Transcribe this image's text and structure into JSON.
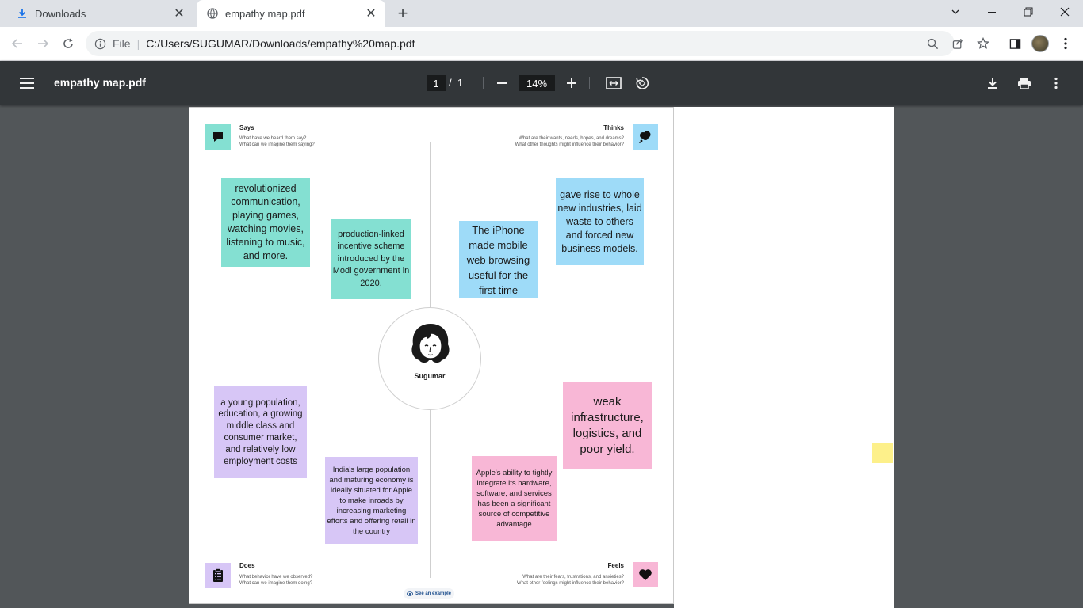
{
  "browser": {
    "tabs": [
      {
        "title": "Downloads",
        "icon": "download-icon",
        "active": false
      },
      {
        "title": "empathy map.pdf",
        "icon": "globe-icon",
        "active": true
      }
    ],
    "omnibox": {
      "scheme_label": "File",
      "url": "C:/Users/SUGUMAR/Downloads/empathy%20map.pdf"
    }
  },
  "pdf_viewer": {
    "title": "empathy map.pdf",
    "current_page": "1",
    "page_separator": "/",
    "total_pages": "1",
    "zoom": "14%"
  },
  "empathy_map": {
    "persona_name": "Sugumar",
    "quadrants": {
      "says": {
        "title": "Says",
        "subtitle_1": "What have we heard them say?",
        "subtitle_2": "What can we imagine them saying?"
      },
      "thinks": {
        "title": "Thinks",
        "subtitle_1": "What are their wants, needs, hopes, and dreams?",
        "subtitle_2": "What other thoughts might influence their behavior?"
      },
      "does": {
        "title": "Does",
        "subtitle_1": "What behavior have we observed?",
        "subtitle_2": "What can we imagine them doing?"
      },
      "feels": {
        "title": "Feels",
        "subtitle_1": "What are their fears, frustrations, and anxieties?",
        "subtitle_2": "What other feelings might influence their behavior?"
      }
    },
    "notes": {
      "says_1": "revolutionized communication, playing games, watching movies, listening to music, and more.",
      "says_2": "production-linked incentive scheme introduced by the Modi government in 2020.",
      "thinks_1": "The iPhone made mobile web browsing useful for the first time",
      "thinks_2": "gave rise to whole new industries, laid waste to others and forced new business models.",
      "does_1": "a young population, education, a growing middle class and consumer market, and relatively low employment costs",
      "does_2": "India's large population and maturing economy is ideally situated for Apple to make inroads by increasing marketing efforts and offering retail in the country",
      "feels_1": "weak infrastructure, logistics, and poor yield.",
      "feels_2": "Apple's ability to tightly integrate its hardware, software, and services has been a significant source of competitive advantage"
    },
    "see_example": "See an example"
  },
  "colors": {
    "teal_note": "#84e0d2",
    "blue_note": "#9edbf8",
    "purple_note": "#d7c6f6",
    "pink_note": "#f8b7d6",
    "viewer_bg": "#525659",
    "pdf_toolbar": "#323639"
  }
}
